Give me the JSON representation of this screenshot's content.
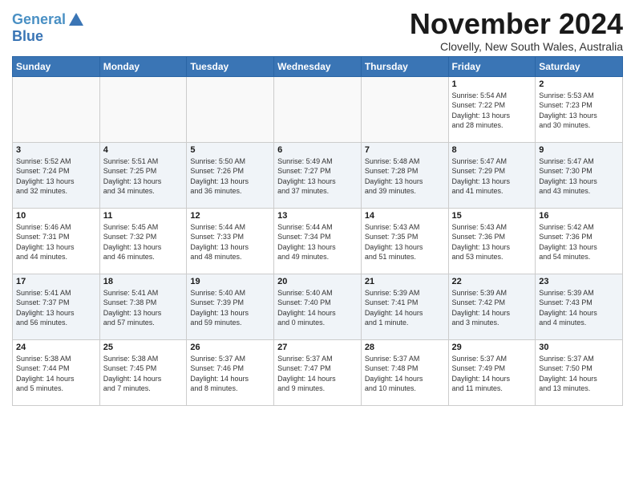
{
  "header": {
    "logo_line1": "General",
    "logo_line2": "Blue",
    "title": "November 2024",
    "subtitle": "Clovelly, New South Wales, Australia"
  },
  "weekdays": [
    "Sunday",
    "Monday",
    "Tuesday",
    "Wednesday",
    "Thursday",
    "Friday",
    "Saturday"
  ],
  "weeks": [
    [
      {
        "day": "",
        "details": ""
      },
      {
        "day": "",
        "details": ""
      },
      {
        "day": "",
        "details": ""
      },
      {
        "day": "",
        "details": ""
      },
      {
        "day": "",
        "details": ""
      },
      {
        "day": "1",
        "details": "Sunrise: 5:54 AM\nSunset: 7:22 PM\nDaylight: 13 hours\nand 28 minutes."
      },
      {
        "day": "2",
        "details": "Sunrise: 5:53 AM\nSunset: 7:23 PM\nDaylight: 13 hours\nand 30 minutes."
      }
    ],
    [
      {
        "day": "3",
        "details": "Sunrise: 5:52 AM\nSunset: 7:24 PM\nDaylight: 13 hours\nand 32 minutes."
      },
      {
        "day": "4",
        "details": "Sunrise: 5:51 AM\nSunset: 7:25 PM\nDaylight: 13 hours\nand 34 minutes."
      },
      {
        "day": "5",
        "details": "Sunrise: 5:50 AM\nSunset: 7:26 PM\nDaylight: 13 hours\nand 36 minutes."
      },
      {
        "day": "6",
        "details": "Sunrise: 5:49 AM\nSunset: 7:27 PM\nDaylight: 13 hours\nand 37 minutes."
      },
      {
        "day": "7",
        "details": "Sunrise: 5:48 AM\nSunset: 7:28 PM\nDaylight: 13 hours\nand 39 minutes."
      },
      {
        "day": "8",
        "details": "Sunrise: 5:47 AM\nSunset: 7:29 PM\nDaylight: 13 hours\nand 41 minutes."
      },
      {
        "day": "9",
        "details": "Sunrise: 5:47 AM\nSunset: 7:30 PM\nDaylight: 13 hours\nand 43 minutes."
      }
    ],
    [
      {
        "day": "10",
        "details": "Sunrise: 5:46 AM\nSunset: 7:31 PM\nDaylight: 13 hours\nand 44 minutes."
      },
      {
        "day": "11",
        "details": "Sunrise: 5:45 AM\nSunset: 7:32 PM\nDaylight: 13 hours\nand 46 minutes."
      },
      {
        "day": "12",
        "details": "Sunrise: 5:44 AM\nSunset: 7:33 PM\nDaylight: 13 hours\nand 48 minutes."
      },
      {
        "day": "13",
        "details": "Sunrise: 5:44 AM\nSunset: 7:34 PM\nDaylight: 13 hours\nand 49 minutes."
      },
      {
        "day": "14",
        "details": "Sunrise: 5:43 AM\nSunset: 7:35 PM\nDaylight: 13 hours\nand 51 minutes."
      },
      {
        "day": "15",
        "details": "Sunrise: 5:43 AM\nSunset: 7:36 PM\nDaylight: 13 hours\nand 53 minutes."
      },
      {
        "day": "16",
        "details": "Sunrise: 5:42 AM\nSunset: 7:36 PM\nDaylight: 13 hours\nand 54 minutes."
      }
    ],
    [
      {
        "day": "17",
        "details": "Sunrise: 5:41 AM\nSunset: 7:37 PM\nDaylight: 13 hours\nand 56 minutes."
      },
      {
        "day": "18",
        "details": "Sunrise: 5:41 AM\nSunset: 7:38 PM\nDaylight: 13 hours\nand 57 minutes."
      },
      {
        "day": "19",
        "details": "Sunrise: 5:40 AM\nSunset: 7:39 PM\nDaylight: 13 hours\nand 59 minutes."
      },
      {
        "day": "20",
        "details": "Sunrise: 5:40 AM\nSunset: 7:40 PM\nDaylight: 14 hours\nand 0 minutes."
      },
      {
        "day": "21",
        "details": "Sunrise: 5:39 AM\nSunset: 7:41 PM\nDaylight: 14 hours\nand 1 minute."
      },
      {
        "day": "22",
        "details": "Sunrise: 5:39 AM\nSunset: 7:42 PM\nDaylight: 14 hours\nand 3 minutes."
      },
      {
        "day": "23",
        "details": "Sunrise: 5:39 AM\nSunset: 7:43 PM\nDaylight: 14 hours\nand 4 minutes."
      }
    ],
    [
      {
        "day": "24",
        "details": "Sunrise: 5:38 AM\nSunset: 7:44 PM\nDaylight: 14 hours\nand 5 minutes."
      },
      {
        "day": "25",
        "details": "Sunrise: 5:38 AM\nSunset: 7:45 PM\nDaylight: 14 hours\nand 7 minutes."
      },
      {
        "day": "26",
        "details": "Sunrise: 5:37 AM\nSunset: 7:46 PM\nDaylight: 14 hours\nand 8 minutes."
      },
      {
        "day": "27",
        "details": "Sunrise: 5:37 AM\nSunset: 7:47 PM\nDaylight: 14 hours\nand 9 minutes."
      },
      {
        "day": "28",
        "details": "Sunrise: 5:37 AM\nSunset: 7:48 PM\nDaylight: 14 hours\nand 10 minutes."
      },
      {
        "day": "29",
        "details": "Sunrise: 5:37 AM\nSunset: 7:49 PM\nDaylight: 14 hours\nand 11 minutes."
      },
      {
        "day": "30",
        "details": "Sunrise: 5:37 AM\nSunset: 7:50 PM\nDaylight: 14 hours\nand 13 minutes."
      }
    ]
  ]
}
